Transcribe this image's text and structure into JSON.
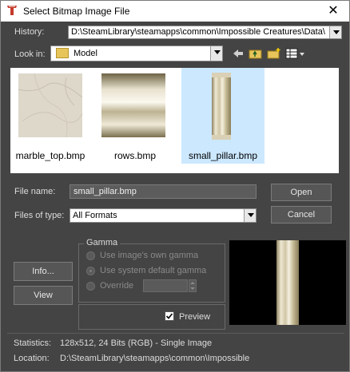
{
  "title": "Select Bitmap Image File",
  "history": {
    "label": "History:",
    "value": "D:\\SteamLibrary\\steamapps\\common\\Impossible Creatures\\Data\\"
  },
  "lookin": {
    "label": "Look in:",
    "value": "Model"
  },
  "files": [
    {
      "name": "marble_top.bmp",
      "selected": false
    },
    {
      "name": "rows.bmp",
      "selected": false
    },
    {
      "name": "small_pillar.bmp",
      "selected": true
    }
  ],
  "filename": {
    "label": "File name:",
    "value": "small_pillar.bmp"
  },
  "filetype": {
    "label": "Files of type:",
    "value": "All Formats"
  },
  "buttons": {
    "open": "Open",
    "cancel": "Cancel",
    "info": "Info...",
    "view": "View"
  },
  "gamma": {
    "title": "Gamma",
    "own": "Use image's own gamma",
    "system": "Use system default gamma",
    "override": "Override",
    "selected": "system"
  },
  "preview": {
    "label": "Preview",
    "checked": true
  },
  "statistics": {
    "label": "Statistics:",
    "value": "128x512, 24 Bits (RGB) - Single Image"
  },
  "location": {
    "label": "Location:",
    "value": "D:\\SteamLibrary\\steamapps\\common\\Impossible"
  },
  "colors": {
    "selection": "#cce8ff",
    "dialog": "#444444"
  }
}
